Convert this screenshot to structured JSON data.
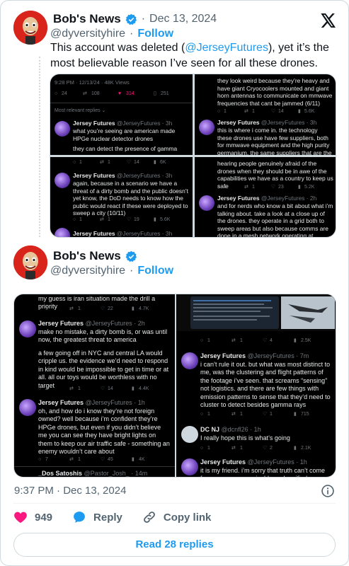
{
  "post1": {
    "name": "Bob's News",
    "date": "Dec 13, 2024",
    "handle": "@dyversityhire",
    "follow": "Follow",
    "text_before": "This account was deleted (",
    "mention": "@JerseyFutures",
    "text_after": "), yet it’s the most believable reason I’ve seen for all these drones."
  },
  "post2": {
    "name": "Bob's News",
    "handle": "@dyversityhire",
    "follow": "Follow"
  },
  "panes1": {
    "a": {
      "header": "9:28 PM · 12/13/24 · 48K Views",
      "stats": [
        "24",
        "108",
        "314",
        "251"
      ],
      "most_relevant": "Most relevant replies ⌄",
      "name": "Jersey Futures",
      "handle": "@JerseyFutures · 3h",
      "text1": "what you’re seeing are american made HPGe nuclear detector drones",
      "text2": "they can detect the presence of gamma rays"
    },
    "b": {
      "text": "they look weird because they’re heavy and have giant Cryocoolers mounted and giant horn antennas to communicate on mmwave frequencies that cant be jammed (6/11)",
      "stats": [
        "1",
        "1",
        "14",
        "5.6K"
      ],
      "name": "Jersey Futures",
      "handle": "@JerseyFutures · 3h",
      "text2": "this is where i come in. the technology these drones use have few suppliers, both for mmwave equipment and the high purity germanium, the same suppliers that are the"
    },
    "c": {
      "name": "Jersey Futures",
      "handle": "@JerseyFutures · 3h",
      "text": "again, because in a scenario we have a threat of a dirty bomb and the public doesn’t yet know, the DoD needs to know how the public would react if these were deployed to sweep a city (10/11)",
      "stats": [
        "1",
        "1",
        "19",
        "5.6K"
      ],
      "name2": "Jersey Futures",
      "handle2": "@JerseyFutures · 3h",
      "top_stats": [
        "1",
        "1",
        "14",
        "6K"
      ]
    },
    "d": {
      "text": "hearing people genuinely afraid of the drones when they should be in awe of the capabilities we have as a country to keep us safe",
      "stats": [
        "1",
        "1",
        "23",
        "5.2K"
      ],
      "name": "Jersey Futures",
      "handle": "@JerseyFutures · 2h",
      "text2": "and for nerds who know a bit about what i’m talking about. take a look at a close up of the drones. they operate in a grid both to sweep areas but also because comms are done in a mesh network operating at 200ghz+ which is"
    }
  },
  "panes2": {
    "a": {
      "top": "my guess is iran situation made the drill a priority",
      "stats0": [
        "1",
        "1",
        "22",
        "4.7K"
      ],
      "name": "Jersey Futures",
      "handle": "@JerseyFutures · 2h",
      "text": "make no mistake, a dirty bomb is, or was until now, the greatest threat to america",
      "text2": "a few going off in NYC and central LA would cripple us. the evidence we’d need to respond in kind would be impossible to get in time or at all. all our toys would be worthless with no target",
      "stats1": [
        "2",
        "1",
        "14",
        "4.4K"
      ],
      "name2": "Jersey Futures",
      "handle2": "@JerseyFutures · 1h",
      "text3": "oh, and how do i know they’re not foreign owned? well because i’m confident they’re HPGe drones, but even if you didn’t believe me you can see they have bright lights on them to keep our air traffic safe - something an enemy wouldn’t care about",
      "stats2": [
        "7",
        "1",
        "45",
        "4K"
      ],
      "name3": "_Dos Satoshis",
      "handle3": "@Pastor_Josh_ · 14m"
    },
    "b": {
      "stats0": [
        "1",
        "1",
        "4",
        "2.5K"
      ],
      "name": "Jersey Futures",
      "handle": "@JerseyFutures · 7m",
      "text": "i can’t rule it out. but what was most distinct to me, was the clustering and flight patterns of the footage i’ve seen. that screams “sensing” not logistics. and there are few things with emission patterns to sense that they’d need to cluster to detect besides gamma rays",
      "stats1": [
        "1",
        "1",
        "1",
        "715"
      ],
      "name2": "DC NJ",
      "handle2": "@dcnfl26 · 1h",
      "text2": "I really hope this is what’s going",
      "stats2": [
        "1",
        "1",
        "2",
        "2.1K"
      ],
      "name3": "Jersey Futures",
      "handle3": "@JerseyFutures · 1h",
      "text3": "it is my friend. i’m sorry that truth can’t come from a more recognizable and verified source of"
    }
  },
  "meta": {
    "time": "9:37 PM · Dec 13, 2024"
  },
  "actions": {
    "likes": "949",
    "reply": "Reply",
    "copy": "Copy link"
  },
  "read_replies": "Read 28 replies",
  "colors": {
    "brand_blue": "#1d9bf0",
    "like_pink": "#f91880",
    "text": "#0f1419",
    "muted": "#536471"
  }
}
